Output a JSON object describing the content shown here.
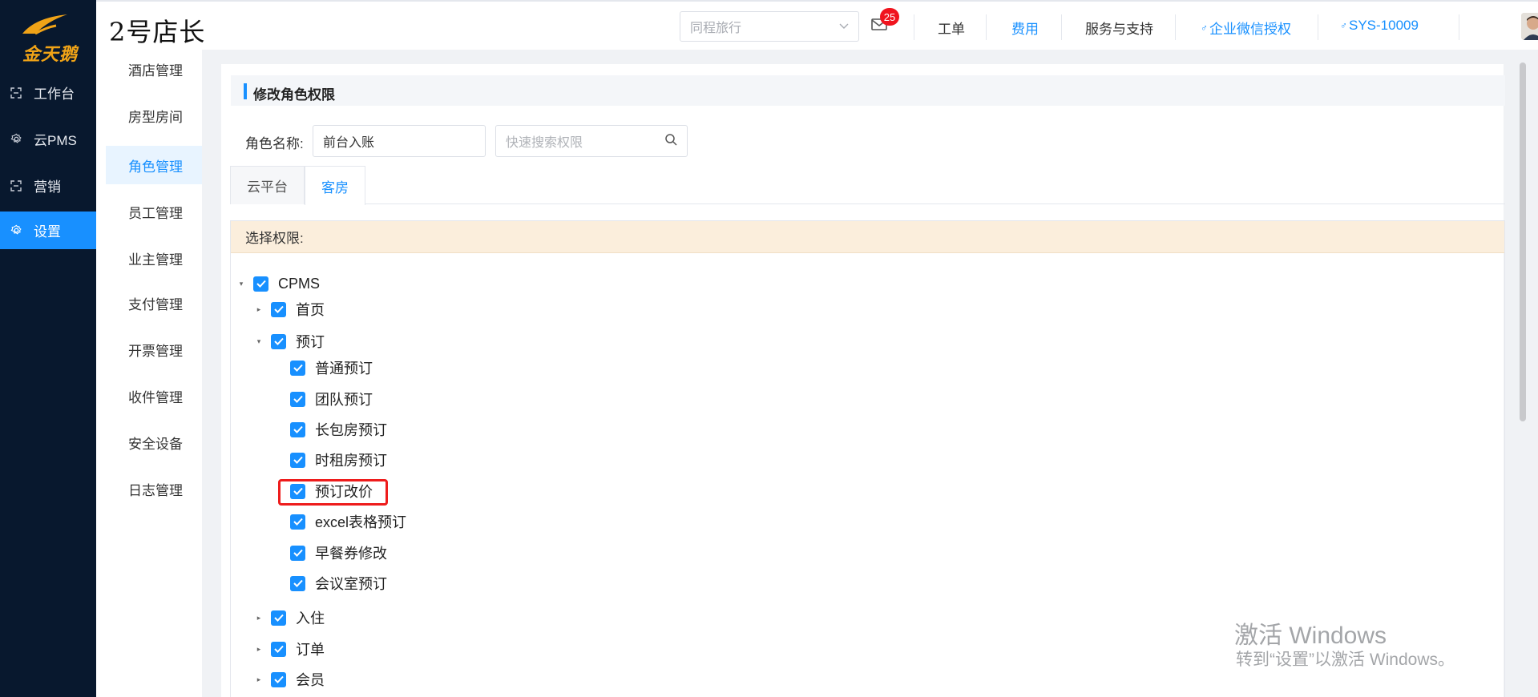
{
  "brand_logo_text": "金天鹅",
  "rail": {
    "items": [
      {
        "label": "工作台",
        "icon": "grid-icon"
      },
      {
        "label": "云PMS",
        "icon": "gear-icon"
      },
      {
        "label": "营销",
        "icon": "grid-icon"
      },
      {
        "label": "设置",
        "icon": "gear-icon",
        "active": true
      }
    ]
  },
  "header": {
    "brand": "2号店长",
    "hotel_select": "同程旅行",
    "mail_count": "25",
    "nav": {
      "ticket": "工单",
      "fees": "费用",
      "service": "服务与支持",
      "wecom": "企业微信授权",
      "user": "SYS-10009"
    }
  },
  "subnav": {
    "items": [
      "酒店管理",
      "房型房间",
      "角色管理",
      "员工管理",
      "业主管理",
      "支付管理",
      "开票管理",
      "收件管理",
      "安全设备",
      "日志管理"
    ],
    "active": "角色管理"
  },
  "page": {
    "title": "修改角色权限",
    "role_label": "角色名称:",
    "role_value": "前台入账",
    "search_placeholder": "快速搜索权限",
    "tabs": [
      "云平台",
      "客房"
    ],
    "active_tab": "客房",
    "perm_header": "选择权限:"
  },
  "tree": {
    "root": "CPMS",
    "home": "首页",
    "booking": "预订",
    "booking_children": [
      "普通预订",
      "团队预订",
      "长包房预订",
      "时租房预订",
      "预订改价",
      "excel表格预订",
      "早餐券修改",
      "会议室预订"
    ],
    "checkin": "入住",
    "orders": "订单",
    "members": "会员"
  },
  "watermark": {
    "line1": "激活 Windows",
    "line2": "转到“设置”以激活 Windows。"
  },
  "colors": {
    "primary": "#1890ff",
    "rail_bg": "#08182e",
    "highlight": "#ee1c1c"
  }
}
